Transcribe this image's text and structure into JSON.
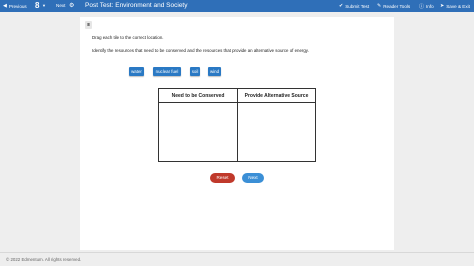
{
  "topbar": {
    "previous_label": "Previous",
    "question_number": "8",
    "next_label": "Next",
    "title": "Post Test: Environment and Society",
    "submit_label": "Submit Test",
    "reader_label": "Reader Tools",
    "info_label": "Info",
    "save_exit_label": "Save & Exit"
  },
  "question": {
    "badge": "8",
    "instruction": "Drag each tile to the correct location.",
    "prompt": "Identify the resources that need to be conserved and the resources that provide an alternative source of energy."
  },
  "tiles": [
    {
      "label": "water"
    },
    {
      "label": "nuclear fuel"
    },
    {
      "label": "soil"
    },
    {
      "label": "wind"
    }
  ],
  "table": {
    "col1_header": "Need to be Conserved",
    "col2_header": "Provide Alternative Source"
  },
  "buttons": {
    "reset_label": "Reset",
    "next_label": "Next"
  },
  "footer": {
    "copyright": "© 2022 Edmentum. All rights reserved."
  },
  "colors": {
    "topbar": "#2f6fb8",
    "tile": "#2a79c4",
    "reset": "#c0392b",
    "next": "#3b8fd6"
  }
}
